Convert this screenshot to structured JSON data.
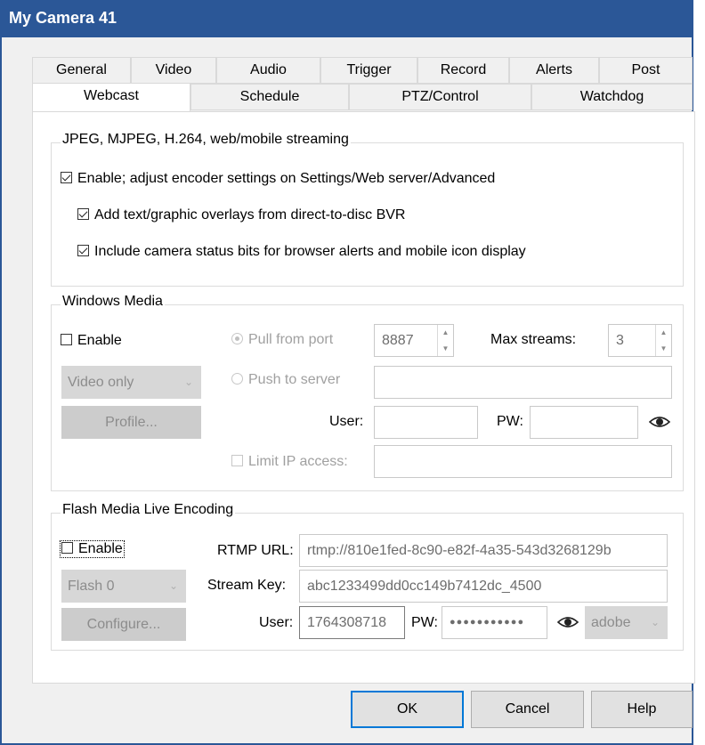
{
  "window": {
    "title": "My Camera 41"
  },
  "tabs": {
    "row1": [
      "General",
      "Video",
      "Audio",
      "Trigger",
      "Record",
      "Alerts",
      "Post"
    ],
    "row2": [
      "Webcast",
      "Schedule",
      "PTZ/Control",
      "Watchdog"
    ],
    "active": "Webcast"
  },
  "jpeg_group": {
    "title": "JPEG, MJPEG, H.264, web/mobile streaming",
    "enable": {
      "label": "Enable; adjust encoder settings on Settings/Web server/Advanced",
      "checked": true
    },
    "overlays": {
      "label": "Add text/graphic overlays from direct-to-disc BVR",
      "checked": true
    },
    "status_bits": {
      "label": "Include camera status bits for browser alerts and mobile icon display",
      "checked": true
    }
  },
  "windows_media": {
    "title": "Windows Media",
    "enable_label": "Enable",
    "enable_checked": false,
    "mode_select": "Video only",
    "profile_button": "Profile...",
    "pull_label": "Pull from port",
    "port_value": "8887",
    "max_streams_label": "Max streams:",
    "max_streams_value": "3",
    "push_label": "Push to server",
    "server_value": "",
    "user_label": "User:",
    "user_value": "",
    "pw_label": "PW:",
    "pw_value": "",
    "limit_ip_label": "Limit IP access:",
    "limit_ip_value": ""
  },
  "flash": {
    "title": "Flash Media Live Encoding",
    "enable_label": "Enable",
    "enable_checked": false,
    "source_select": "Flash 0",
    "configure_button": "Configure...",
    "rtmp_label": "RTMP URL:",
    "rtmp_value": "rtmp://810e1fed-8c90-e82f-4a35-543d3268129b",
    "stream_key_label": "Stream Key:",
    "stream_key_value": "abc1233499dd0cc149b7412dc_4500",
    "user_label": "User:",
    "user_value": "1764308718",
    "pw_label": "PW:",
    "pw_value": "●●●●●●●●●●●",
    "auth_select": "adobe"
  },
  "footer": {
    "ok": "OK",
    "cancel": "Cancel",
    "help": "Help"
  }
}
